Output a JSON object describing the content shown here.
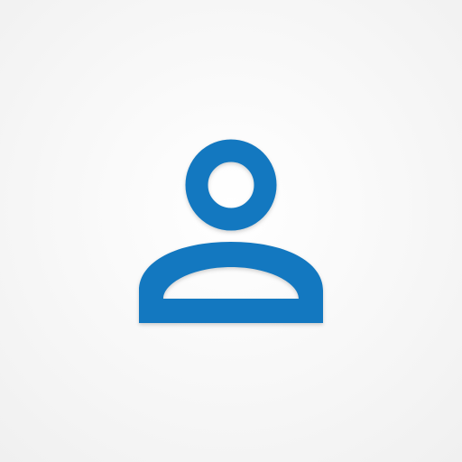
{
  "icon": {
    "name": "user-profile-icon",
    "primary_color": "#1378C0",
    "background_color": "#F4F4F4"
  }
}
